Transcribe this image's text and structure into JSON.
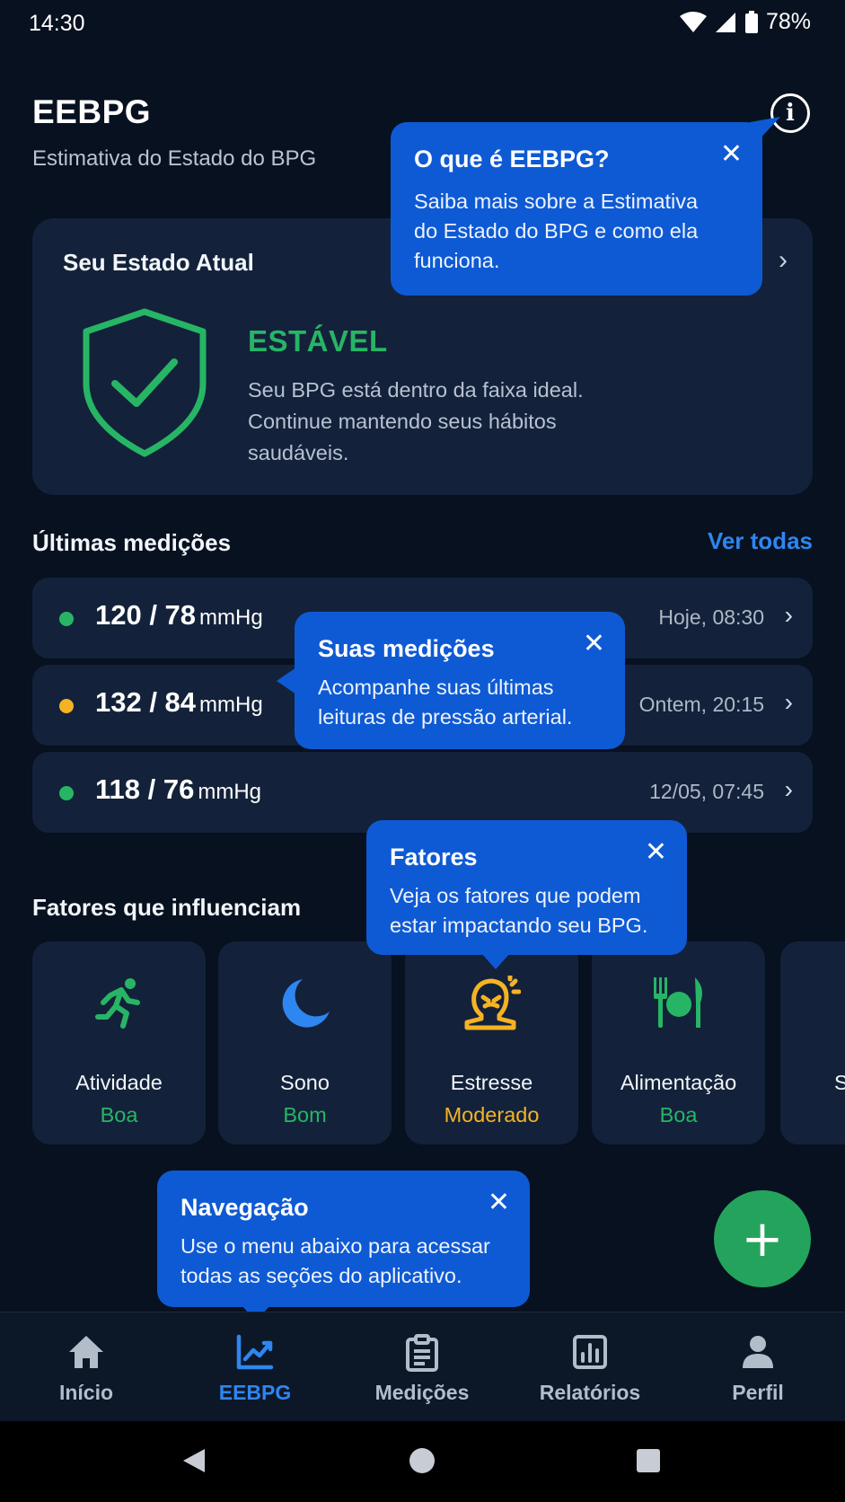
{
  "status_bar": {
    "time": "14:30",
    "battery": "78%"
  },
  "header": {
    "title": "EEBPG",
    "subtitle": "Estimativa do Estado do BPG"
  },
  "state_card": {
    "title": "Seu Estado Atual",
    "status": "ESTÁVEL",
    "description": "Seu BPG está dentro da faixa ideal. Continue mantendo seus hábitos saudáveis.",
    "status_color": "#27b565"
  },
  "measurements": {
    "title": "Últimas medições",
    "see_all": "Ver todas",
    "items": [
      {
        "value": "120 / 78",
        "unit": "mmHg",
        "time": "Hoje, 08:30",
        "color": "#27b565"
      },
      {
        "value": "132 / 84",
        "unit": "mmHg",
        "time": "Ontem, 20:15",
        "color": "#f5b324"
      },
      {
        "value": "118 / 76",
        "unit": "mmHg",
        "time": "12/05, 07:45",
        "color": "#27b565"
      }
    ]
  },
  "factors": {
    "title": "Fatores que influenciam",
    "items": [
      {
        "name": "Atividade",
        "status": "Boa",
        "icon": "running-icon",
        "color": "#27b565"
      },
      {
        "name": "Sono",
        "status": "Bom",
        "icon": "moon-icon",
        "color": "#27b565"
      },
      {
        "name": "Estresse",
        "status": "Moderado",
        "icon": "stress-head-icon",
        "color": "#f5b324"
      },
      {
        "name": "Alimentação",
        "status": "Boa",
        "icon": "food-icon",
        "color": "#27b565"
      },
      {
        "name": "S",
        "status": "",
        "icon": "partial-icon",
        "color": "#27b565"
      }
    ]
  },
  "tooltips": {
    "info": {
      "title": "O que é EEBPG?",
      "body_lines": [
        "Saiba mais sobre a Estimativa",
        "do Estado do BPG e como ela",
        "funciona."
      ]
    },
    "measurements": {
      "title": "Suas medições",
      "body_lines": [
        "Acompanhe suas últimas",
        "leituras de pressão arterial."
      ]
    },
    "factors": {
      "title": "Fatores",
      "body_lines": [
        "Veja os fatores que podem",
        "estar impactando seu BPG."
      ]
    },
    "navigation": {
      "title": "Navegação",
      "body_lines": [
        "Use o menu abaixo para acessar",
        "todas as seções do aplicativo."
      ]
    },
    "close_glyph": "✕"
  },
  "fab": {
    "label": "+"
  },
  "bottom_nav": {
    "items": [
      {
        "label": "Início",
        "icon": "home-icon",
        "active": false
      },
      {
        "label": "EEBPG",
        "icon": "chart-line-icon",
        "active": true
      },
      {
        "label": "Medições",
        "icon": "clipboard-icon",
        "active": false
      },
      {
        "label": "Relatórios",
        "icon": "report-icon",
        "active": false
      },
      {
        "label": "Perfil",
        "icon": "user-icon",
        "active": false
      }
    ],
    "active_color": "#2e86f0"
  }
}
